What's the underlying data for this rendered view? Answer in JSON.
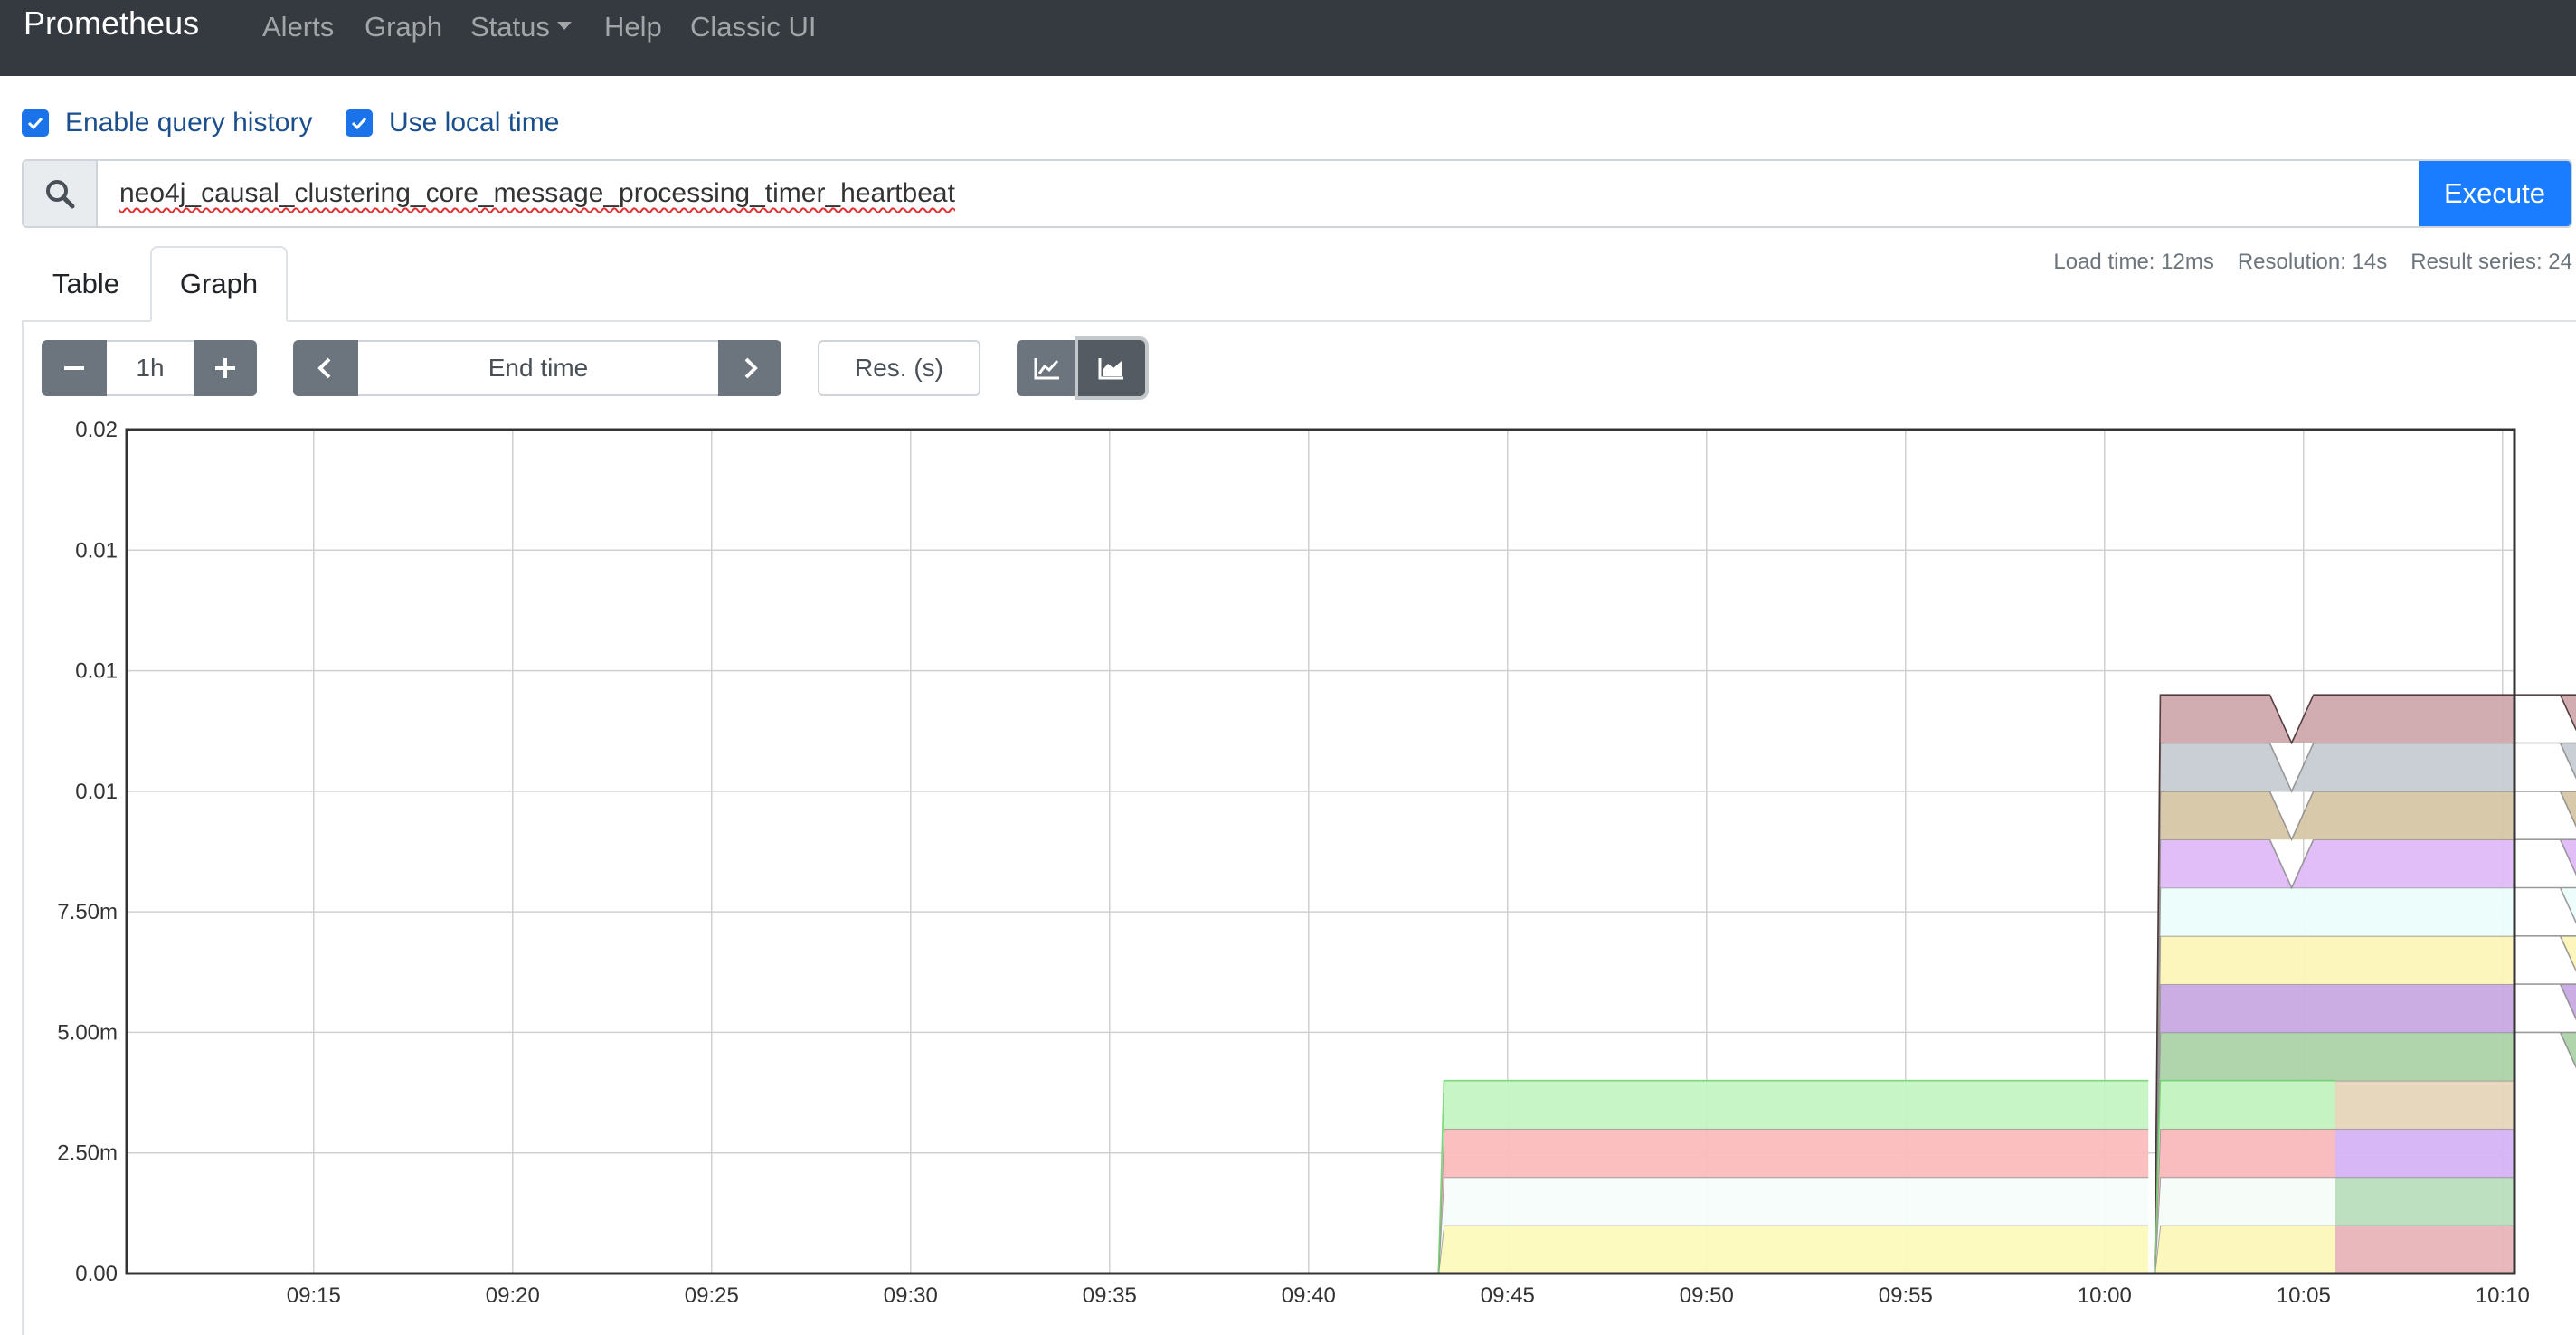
{
  "navbar": {
    "brand": "Prometheus",
    "items": [
      {
        "label": "Alerts"
      },
      {
        "label": "Graph"
      },
      {
        "label": "Status"
      },
      {
        "label": "Help"
      },
      {
        "label": "Classic UI"
      }
    ]
  },
  "options": {
    "query_history_label": "Enable query history",
    "query_history_checked": true,
    "local_time_label": "Use local time",
    "local_time_checked": true
  },
  "query": {
    "value": "neo4j_causal_clustering_core_message_processing_timer_heartbeat",
    "execute_label": "Execute",
    "search_icon": "search-icon"
  },
  "tabs": [
    {
      "label": "Table",
      "active": false
    },
    {
      "label": "Graph",
      "active": true
    }
  ],
  "stats": {
    "load_time": "Load time: 12ms",
    "resolution": "Resolution: 14s",
    "result_series": "Result series: 24"
  },
  "controls": {
    "range_value": "1h",
    "end_time_placeholder": "End time",
    "resolution_placeholder": "Res. (s)",
    "minus_icon": "minus-icon",
    "plus_icon": "plus-icon",
    "prev_icon": "chevron-left-icon",
    "next_icon": "chevron-right-icon",
    "line_chart_icon": "line-chart-icon",
    "stacked_chart_icon": "area-chart-icon"
  },
  "chart_data": {
    "type": "area",
    "stacked": true,
    "x_ticks": [
      "09:15",
      "09:20",
      "09:25",
      "09:30",
      "09:35",
      "09:40",
      "09:45",
      "09:50",
      "09:55",
      "10:00",
      "10:05",
      "10:10"
    ],
    "y_ticks": [
      "0.00",
      "2.50m",
      "5.00m",
      "7.50m",
      "0.01",
      "0.01",
      "0.01",
      "0.02"
    ],
    "ylim": [
      0,
      0.0175
    ],
    "xlim_minutes": [
      -4.7,
      55.3
    ],
    "grid": true,
    "legend": "none",
    "series": [
      {
        "color": "#e8b4b8",
        "start": 46.4,
        "end": 55.3,
        "value": 0.001
      },
      {
        "color": "#b9dfbd",
        "start": 46.4,
        "end": 55.3,
        "value": 0.001
      },
      {
        "color": "#d5b3f5",
        "start": 46.4,
        "end": 55.3,
        "value": 0.001
      },
      {
        "color": "#e6d5b9",
        "start": 46.4,
        "end": 55.3,
        "value": 0.001
      },
      {
        "color": "#acd3a9",
        "start": 46.4,
        "end": 55.3,
        "value": 0.001,
        "dips": [
          10.6,
          11.8
        ]
      },
      {
        "color": "#c8a9e2",
        "start": 46.4,
        "end": 55.3,
        "value": 0.001,
        "dips": [
          10.6,
          11.8
        ]
      },
      {
        "color": "#fcf4b8",
        "start": 46.4,
        "end": 55.3,
        "value": 0.001,
        "dips": [
          10.6,
          11.8
        ]
      },
      {
        "color": "#ecfdfb",
        "start": 46.4,
        "end": 55.3,
        "value": 0.001,
        "dips": [
          10.6,
          11.8
        ]
      },
      {
        "color": "#e0baf8",
        "start": 46.4,
        "end": 55.3,
        "value": 0.001,
        "dips": [
          3.3,
          10.6,
          11.8
        ]
      },
      {
        "color": "#d6c6a5",
        "start": 46.4,
        "end": 55.3,
        "value": 0.001,
        "dips": [
          3.3,
          10.6,
          11.8
        ]
      },
      {
        "color": "#c6ccd3",
        "start": 46.4,
        "end": 55.3,
        "value": 0.001,
        "dips": [
          3.3,
          10.6,
          11.8
        ]
      },
      {
        "color": "#cfa8ad",
        "start": 46.4,
        "end": 55.3,
        "value": 0.001,
        "dips": [
          3.3,
          10.6,
          11.8
        ]
      },
      {
        "color": "#fdfabc",
        "start": 46.4,
        "end": 50.8,
        "value": 0.001
      },
      {
        "color": "#f9fdfb",
        "start": 46.4,
        "end": 50.8,
        "value": 0.001
      },
      {
        "color": "#fbbcbc",
        "start": 46.4,
        "end": 50.8,
        "value": 0.001
      },
      {
        "color": "#c4f4c2",
        "start": 46.4,
        "end": 50.8,
        "value": 0.001
      },
      {
        "color": "#fdfabc",
        "start": 28.4,
        "end": 46.1,
        "value": 0.001
      },
      {
        "color": "#f6fdfb",
        "start": 28.4,
        "end": 46.1,
        "value": 0.001
      },
      {
        "color": "#fbbcbc",
        "start": 28.4,
        "end": 46.1,
        "value": 0.001
      },
      {
        "color": "#c4f4c2",
        "start": 28.4,
        "end": 46.1,
        "value": 0.001
      }
    ]
  }
}
